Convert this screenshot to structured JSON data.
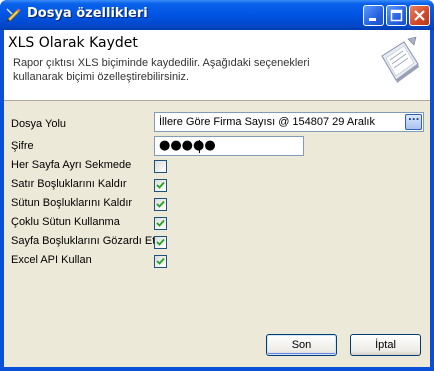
{
  "window": {
    "title": "Dosya özellikleri",
    "title_icon": "pencil-ruler-icon",
    "controls": {
      "minimize_icon": "minimize-icon",
      "maximize_icon": "maximize-icon",
      "close_icon": "close-icon"
    }
  },
  "header": {
    "title": "XLS Olarak Kaydet",
    "description": "Rapor çıktısı XLS biçiminde kaydedilir. Aşağıdaki seçenekleri kullanarak biçimi özelleştirebilirsiniz.",
    "icon": "document-save-icon"
  },
  "form": {
    "file_path": {
      "label": "Dosya Yolu",
      "value": "İllere Göre Firma Sayısı @ 154807 29 Aralık",
      "browse_label": "..."
    },
    "password": {
      "label": "Şifre",
      "masked_value": "●●●●●"
    },
    "options": [
      {
        "label": "Her Sayfa Ayrı Sekmede",
        "checked": false
      },
      {
        "label": "Satır Boşluklarını Kaldır",
        "checked": true
      },
      {
        "label": "Sütun Boşluklarını Kaldır",
        "checked": true
      },
      {
        "label": "Çoklu Sütun Kullanma",
        "checked": true
      },
      {
        "label": "Sayfa Boşluklarını Gözardı Et",
        "checked": true
      },
      {
        "label": "Excel API Kullan",
        "checked": true
      }
    ]
  },
  "buttons": {
    "ok": "Son",
    "cancel": "İptal"
  },
  "colors": {
    "titlebar": "#0054e3",
    "dialog_bg": "#ece9d8",
    "checkmark": "#21a121"
  }
}
